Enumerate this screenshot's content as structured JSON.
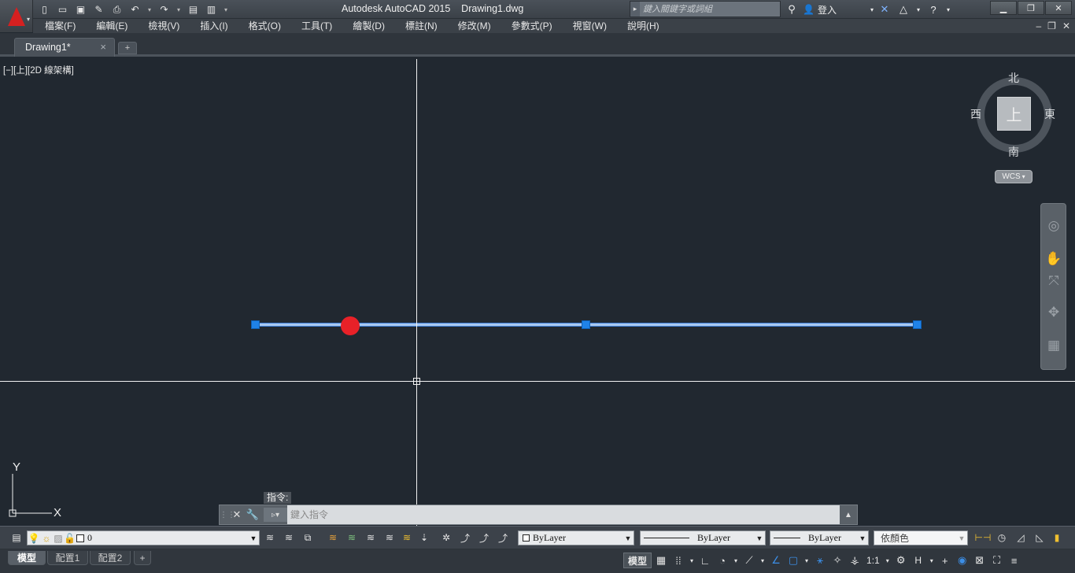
{
  "app": {
    "title": "Autodesk AutoCAD 2015    Drawing1.dwg",
    "accent_color": "#d62020"
  },
  "search": {
    "placeholder": "鍵入關鍵字或詞組"
  },
  "signin": {
    "label": "登入"
  },
  "menu": {
    "items": [
      "檔案(F)",
      "編輯(E)",
      "檢視(V)",
      "插入(I)",
      "格式(O)",
      "工具(T)",
      "繪製(D)",
      "標註(N)",
      "修改(M)",
      "參數式(P)",
      "視窗(W)",
      "說明(H)"
    ]
  },
  "tabs": {
    "document": "Drawing1*",
    "close_glyph": "×",
    "new_glyph": "+"
  },
  "viewport": {
    "label": "[−][上][2D 線架構]",
    "selection_color": "#1f82e8",
    "hot_grip_color": "#e82128"
  },
  "viewcube": {
    "north": "北",
    "south": "南",
    "east": "東",
    "west": "西",
    "face": "上",
    "wcs": "WCS"
  },
  "ucs": {
    "x": "X",
    "y": "Y"
  },
  "command": {
    "history": "指令:",
    "placeholder": "鍵入指令"
  },
  "properties": {
    "layer": "0",
    "color": "ByLayer",
    "linetype": "ByLayer",
    "lineweight": "ByLayer",
    "plotstyle": "依顏色"
  },
  "layouts": {
    "tabs": [
      "模型",
      "配置1",
      "配置2"
    ],
    "add": "+"
  },
  "status": {
    "model": "模型",
    "scale": "1:1",
    "workspace": "H"
  }
}
